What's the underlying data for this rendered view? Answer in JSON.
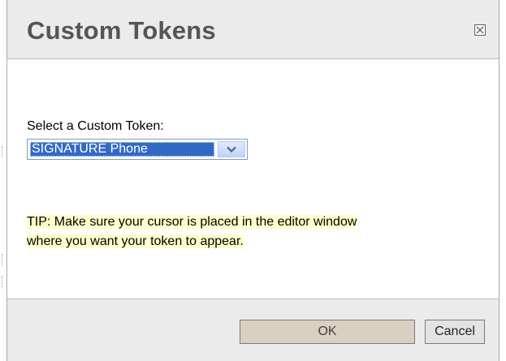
{
  "dialog": {
    "title": "Custom Tokens",
    "close_icon": "close-box-icon"
  },
  "form": {
    "select_label": "Select a Custom Token:",
    "select_value": "SIGNATURE Phone",
    "dropdown_icon": "chevron-down-icon"
  },
  "tip": {
    "line1": "TIP: Make sure your cursor is placed in the editor window",
    "line2": "where you want your token to appear."
  },
  "buttons": {
    "ok_label": "OK",
    "cancel_label": "Cancel"
  },
  "colors": {
    "selection": "#316ac5",
    "tip_highlight": "#ffffcc",
    "ok_button": "#d9d0c1"
  }
}
